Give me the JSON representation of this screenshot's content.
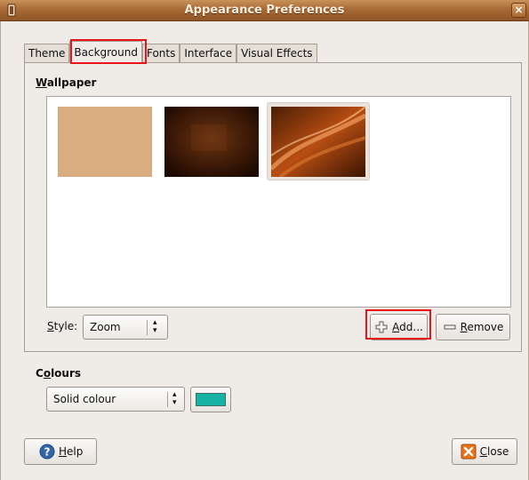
{
  "window": {
    "title": "Appearance Preferences",
    "close_glyph": "×"
  },
  "tabs": [
    {
      "label": "Theme"
    },
    {
      "label": "Background"
    },
    {
      "label": "Fonts"
    },
    {
      "label": "Interface"
    },
    {
      "label": "Visual Effects"
    }
  ],
  "wallpaper": {
    "section_first": "W",
    "section_rest": "allpaper",
    "thumbnails": [
      "tan-solid",
      "dark-brown-texture",
      "orange-brown-swirl"
    ],
    "selected_thumbnail": "orange-brown-swirl"
  },
  "style": {
    "label_first": "S",
    "label_rest": "tyle:",
    "value": "Zoom"
  },
  "buttons": {
    "add_first": "A",
    "add_rest": "dd...",
    "remove_first": "R",
    "remove_rest": "emove",
    "help_first": "H",
    "help_rest": "elp",
    "close_first": "C",
    "close_rest": "lose"
  },
  "colours": {
    "section_first": "C",
    "section_mid": "o",
    "section_rest": "lours",
    "shade_type": "Solid colour",
    "swatch_color": "#16b3a4"
  },
  "colors": {
    "titlebar": "#a86a36",
    "highlight": "#e8151d",
    "swatch": "#16b3a4"
  }
}
